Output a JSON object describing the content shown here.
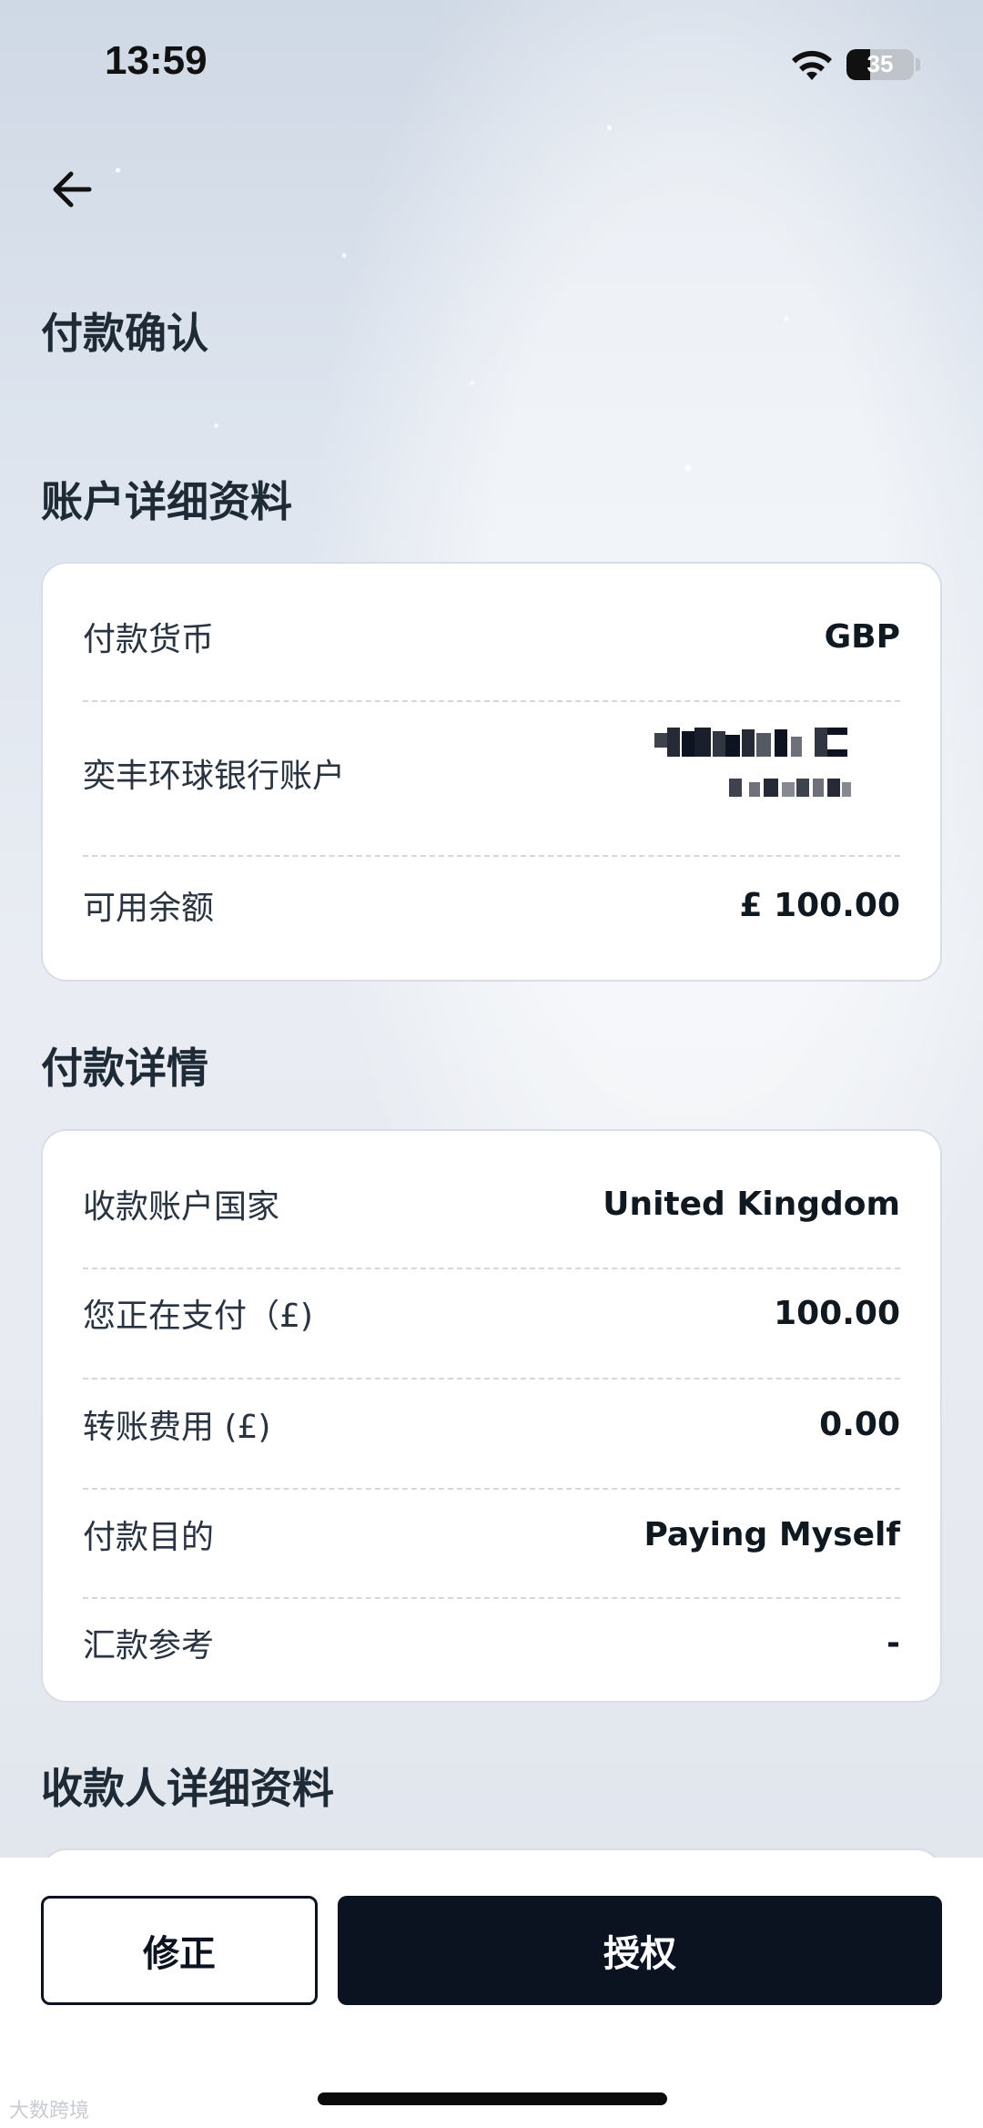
{
  "status_bar": {
    "time": "13:59",
    "battery": "35",
    "battery_level": 0.35
  },
  "page_title": "付款确认",
  "account_section": {
    "title": "账户详细资料",
    "rows": [
      {
        "label": "付款货币",
        "value": "GBP"
      },
      {
        "label": "奕丰环球银行账户",
        "value": ""
      },
      {
        "label": "可用余额",
        "value": "£ 100.00"
      }
    ]
  },
  "payment_section": {
    "title": "付款详情",
    "rows": [
      {
        "label": "收款账户国家",
        "value": "United Kingdom"
      },
      {
        "label": "您正在支付（£)",
        "value": "100.00"
      },
      {
        "label": "转账费用 (£)",
        "value": "0.00"
      },
      {
        "label": "付款目的",
        "value": "Paying Myself"
      },
      {
        "label": "汇款参考",
        "value": "-"
      }
    ]
  },
  "payee_section": {
    "title": "收款人详细资料"
  },
  "actions": {
    "edit_label": "修正",
    "authorize_label": "授权"
  },
  "watermark": "大数跨境",
  "icons": {
    "back": "arrow-left-icon",
    "wifi": "wifi-icon",
    "battery": "battery-icon"
  }
}
